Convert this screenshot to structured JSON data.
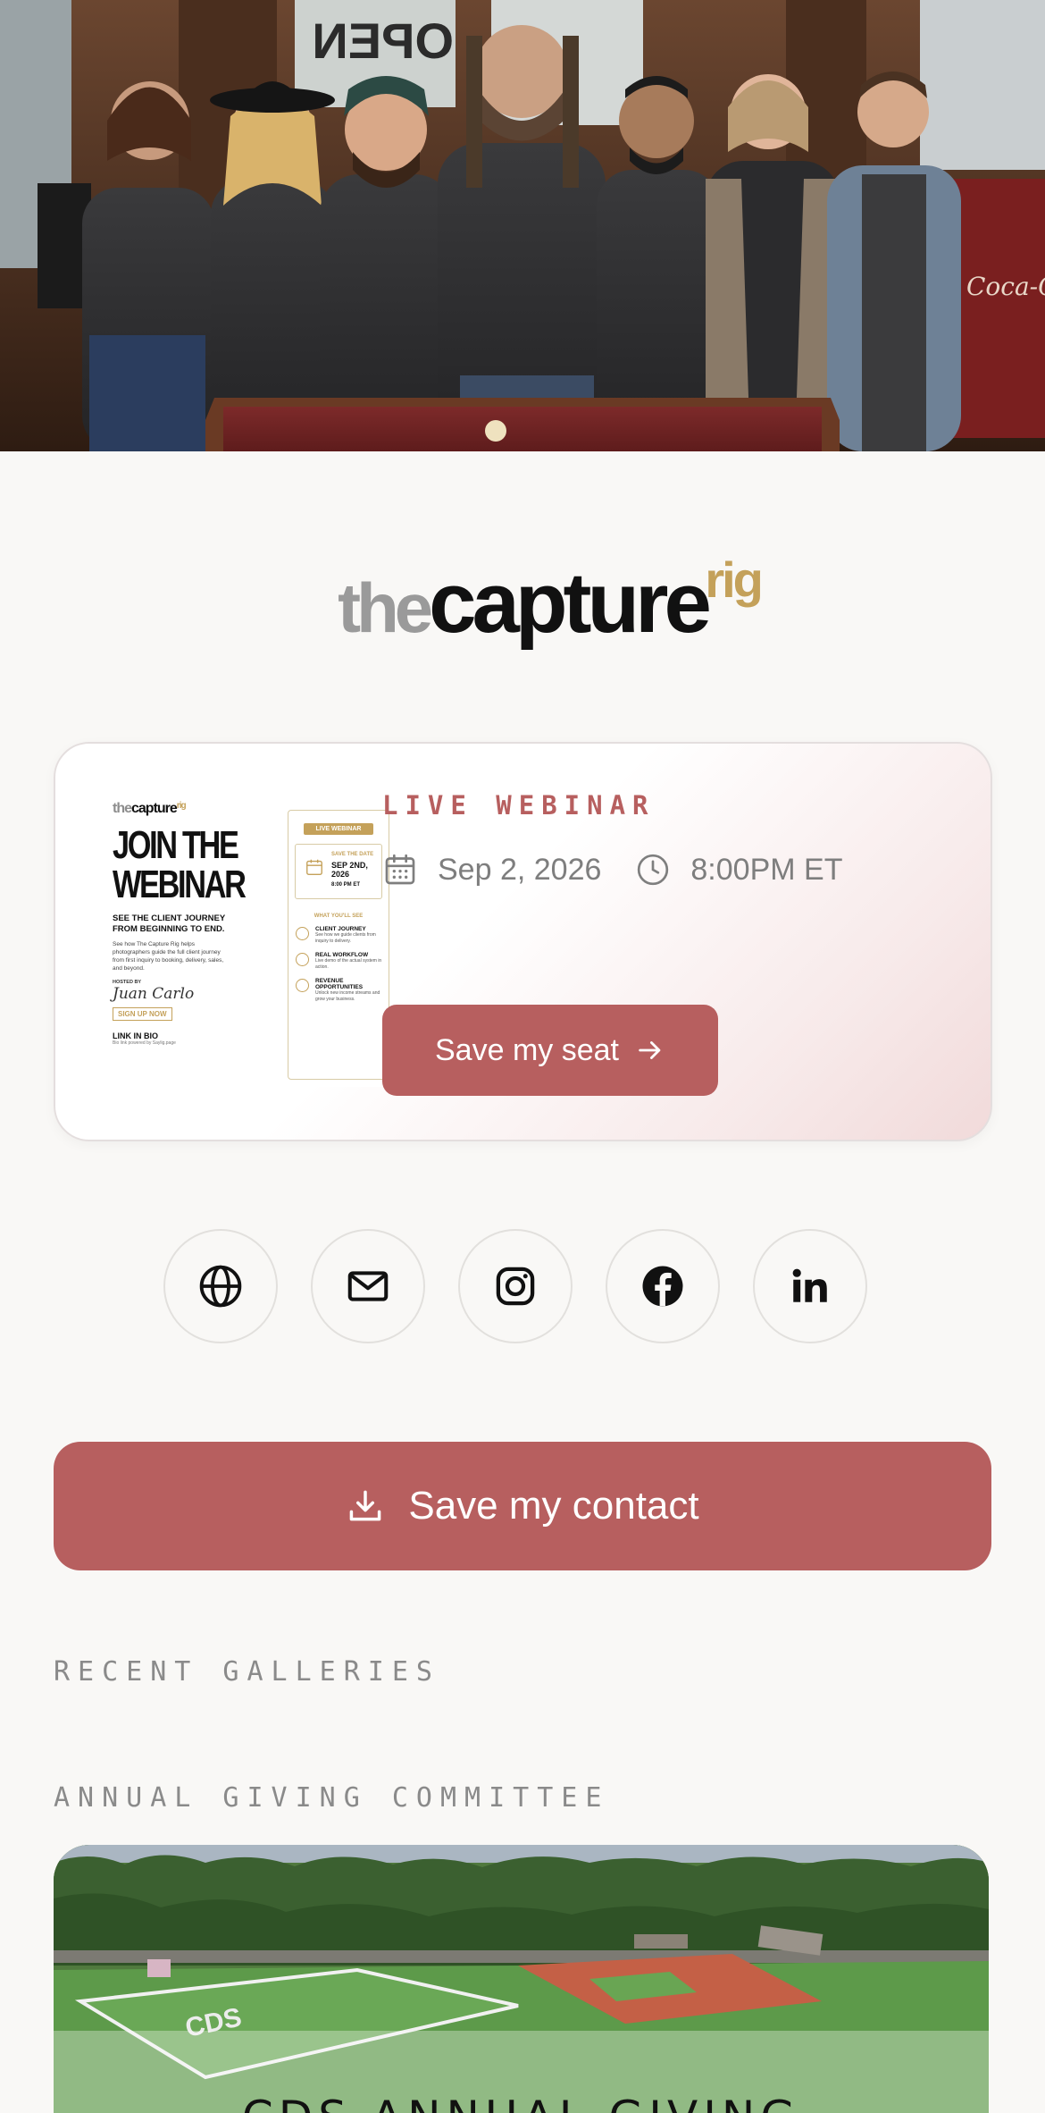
{
  "hero": {
    "open_sign": "OPEN",
    "soda_sign": "Coca-Cola"
  },
  "logo": {
    "the": "the",
    "capture": "capture",
    "rig": "rig"
  },
  "webinar": {
    "label": "LIVE WEBINAR",
    "date": "Sep 2, 2026",
    "time": "8:00PM ET",
    "button_label": "Save my seat",
    "flyer": {
      "brand_the": "the",
      "brand_capture": "capture",
      "brand_rig": "rig",
      "headline_1": "JOIN THE",
      "headline_2": "WEBINAR",
      "subhead": "SEE THE CLIENT JOURNEY FROM BEGINNING TO END.",
      "body": "See how The Capture Rig helps photographers guide the full client journey from first inquiry to booking, delivery, sales, and beyond.",
      "hosted_by": "HOSTED BY",
      "host_signature": "Juan Carlo",
      "signup": "SIGN UP NOW",
      "link_in_bio": "LINK IN BIO",
      "powered": "Bio link powered by Saylig.page",
      "badge": "LIVE WEBINAR",
      "save_the_date": "SAVE THE DATE",
      "date_big": "SEP 2ND, 2026",
      "time_small": "8:00 PM ET",
      "what_see": "WHAT YOU'LL SEE",
      "items": [
        {
          "title": "CLIENT JOURNEY",
          "desc": "See how we guide clients from inquiry to delivery."
        },
        {
          "title": "REAL WORKFLOW",
          "desc": "Live demo of the actual system in action."
        },
        {
          "title": "REVENUE OPPORTUNITIES",
          "desc": "Unlock new income streams and grow your business."
        }
      ]
    }
  },
  "social": [
    {
      "icon": "globe-icon"
    },
    {
      "icon": "mail-icon"
    },
    {
      "icon": "instagram-icon"
    },
    {
      "icon": "facebook-icon"
    },
    {
      "icon": "linkedin-icon"
    }
  ],
  "contact": {
    "button_label": "Save my contact"
  },
  "recent_galleries_label": "RECENT GALLERIES",
  "gallery": {
    "group_label": "ANNUAL GIVING COMMITTEE",
    "field_text": "CDS",
    "title": "CDS ANNUAL GIVING"
  },
  "colors": {
    "accent": "#b75f5f",
    "gold": "#c4a15a",
    "background": "#f9f8f6"
  }
}
